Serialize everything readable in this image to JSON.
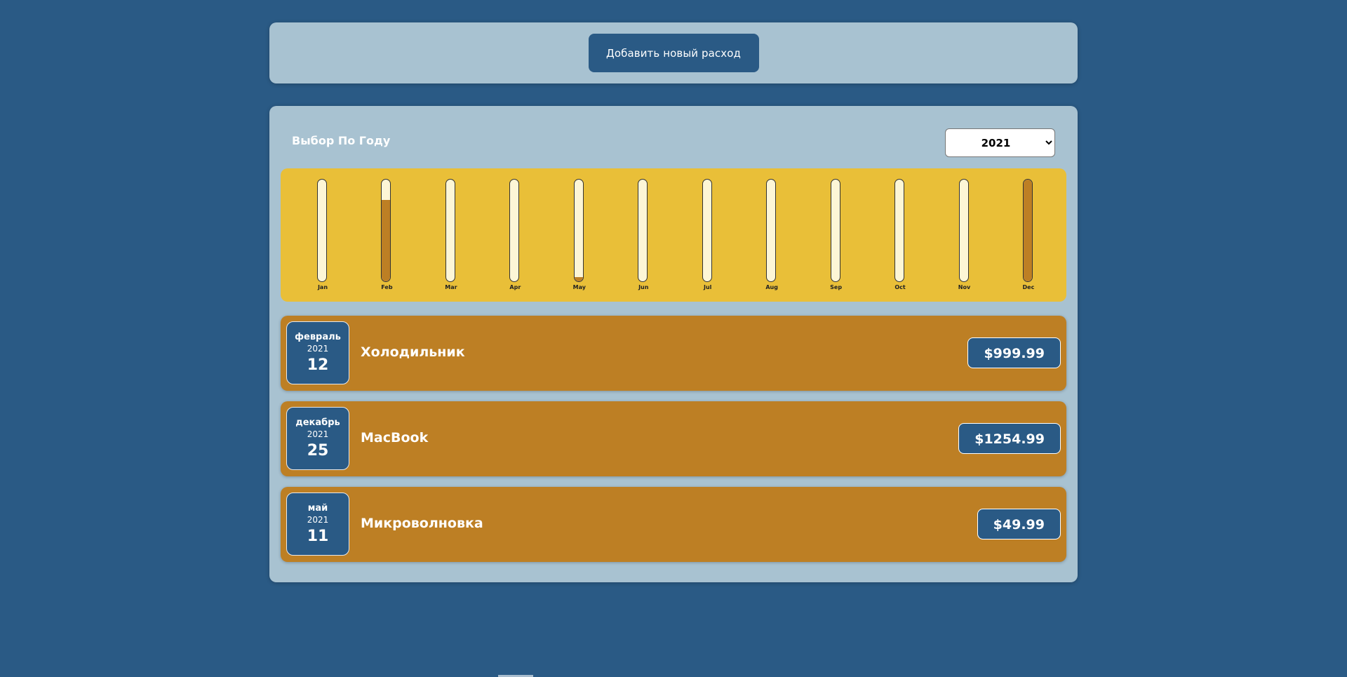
{
  "header": {
    "add_button_label": "Добавить новый расход"
  },
  "filter": {
    "label": "Выбор По Году",
    "selected_year": "2021",
    "options": [
      "2021"
    ]
  },
  "chart_data": {
    "type": "bar",
    "categories": [
      "Jan",
      "Feb",
      "Mar",
      "Apr",
      "May",
      "Jun",
      "Jul",
      "Aug",
      "Sep",
      "Oct",
      "Nov",
      "Dec"
    ],
    "values": [
      0,
      999.99,
      0,
      0,
      49.99,
      0,
      0,
      0,
      0,
      0,
      0,
      1254.99
    ],
    "max": 1254.99,
    "colors": {
      "track": "#fdf6d6",
      "fill": "#bd7f24",
      "background": "#e9bf38"
    }
  },
  "expenses": [
    {
      "month": "февраль",
      "year": "2021",
      "day": "12",
      "title": "Холодильник",
      "amount": "$999.99"
    },
    {
      "month": "декабрь",
      "year": "2021",
      "day": "25",
      "title": "MacBook",
      "amount": "$1254.99"
    },
    {
      "month": "май",
      "year": "2021",
      "day": "11",
      "title": "Микроволновка",
      "amount": "$49.99"
    }
  ],
  "colors": {
    "page_bg": "#2a5a85",
    "panel_bg": "#a8c2d1",
    "item_bg": "#bd7f24",
    "accent": "#2a5a85"
  }
}
